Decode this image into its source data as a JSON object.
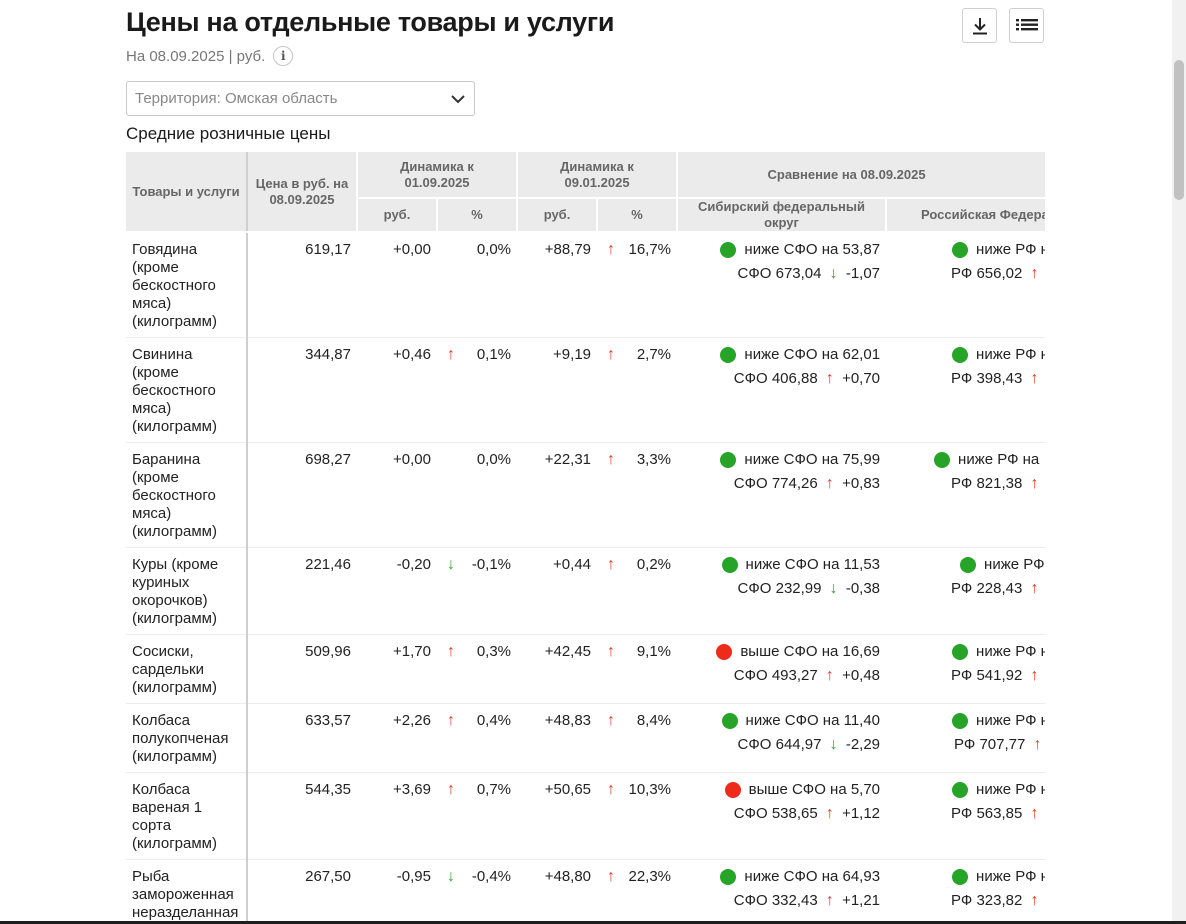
{
  "header": {
    "title": "Цены на отдельные товары и услуги",
    "subtitle": "На 08.09.2025 | руб.",
    "info_icon": "i"
  },
  "toolbar": {
    "download_icon": "download-icon",
    "list_icon": "list-icon"
  },
  "territory_select": {
    "value": "Территория: Омская область"
  },
  "section_title": "Средние розничные цены",
  "colors": {
    "up": "#e33a1f",
    "down": "#2ea52e",
    "dot_green": "#27a327",
    "dot_red": "#ee2a1b",
    "header_bg": "#ebebeb"
  },
  "table": {
    "headers": {
      "goods": "Товары и услуги",
      "price": "Цена в руб. на 08.09.2025",
      "dyn1": "Динамика к 01.09.2025",
      "dyn2": "Динамика к 09.01.2025",
      "compare": "Сравнение на 08.09.2025",
      "sfo": "Сибирский федеральный округ",
      "rf": "Российская Федерация",
      "rub": "руб.",
      "pct": "%"
    },
    "rows": [
      {
        "name": "Говядина (кроме бескостного мяса) (килограмм)",
        "price": "619,17",
        "d1_rub": "+0,00",
        "d1_dir": "",
        "d1_pct": "0,0%",
        "d2_rub": "+88,79",
        "d2_dir": "up",
        "d2_pct": "16,7%",
        "sfo_dot": "green",
        "sfo_text": "ниже СФО на 53,87",
        "sfo_value": "СФО 673,04",
        "sfo_dir": "down",
        "sfo_delta": "-1,07",
        "rf_dot": "green",
        "rf_text": "ниже РФ на",
        "rf_value": "РФ 656,02",
        "rf_dir": "up"
      },
      {
        "name": "Свинина (кроме бескостного мяса) (килограмм)",
        "price": "344,87",
        "d1_rub": "+0,46",
        "d1_dir": "up",
        "d1_pct": "0,1%",
        "d2_rub": "+9,19",
        "d2_dir": "up",
        "d2_pct": "2,7%",
        "sfo_dot": "green",
        "sfo_text": "ниже СФО на 62,01",
        "sfo_value": "СФО 406,88",
        "sfo_dir": "up",
        "sfo_delta": "+0,70",
        "rf_dot": "green",
        "rf_text": "ниже РФ на",
        "rf_value": "РФ 398,43",
        "rf_dir": "up"
      },
      {
        "name": "Баранина (кроме бескостного мяса) (килограмм)",
        "price": "698,27",
        "d1_rub": "+0,00",
        "d1_dir": "",
        "d1_pct": "0,0%",
        "d2_rub": "+22,31",
        "d2_dir": "up",
        "d2_pct": "3,3%",
        "sfo_dot": "green",
        "sfo_text": "ниже СФО на 75,99",
        "sfo_value": "СФО 774,26",
        "sfo_dir": "up",
        "sfo_delta": "+0,83",
        "rf_dot": "green",
        "rf_text": "ниже РФ на",
        "rf_value": "РФ 821,38",
        "rf_dir": "up"
      },
      {
        "name": "Куры (кроме куриных окорочков) (килограмм)",
        "price": "221,46",
        "d1_rub": "-0,20",
        "d1_dir": "down",
        "d1_pct": "-0,1%",
        "d2_rub": "+0,44",
        "d2_dir": "up",
        "d2_pct": "0,2%",
        "sfo_dot": "green",
        "sfo_text": "ниже СФО на 11,53",
        "sfo_value": "СФО 232,99",
        "sfo_dir": "down",
        "sfo_delta": "-0,38",
        "rf_dot": "green",
        "rf_text": "ниже РФ н",
        "rf_value": "РФ 228,43",
        "rf_dir": "up"
      },
      {
        "name": "Сосиски, сардельки (килограмм)",
        "price": "509,96",
        "d1_rub": "+1,70",
        "d1_dir": "up",
        "d1_pct": "0,3%",
        "d2_rub": "+42,45",
        "d2_dir": "up",
        "d2_pct": "9,1%",
        "sfo_dot": "red",
        "sfo_text": "выше СФО на 16,69",
        "sfo_value": "СФО 493,27",
        "sfo_dir": "up",
        "sfo_delta": "+0,48",
        "rf_dot": "green",
        "rf_text": "ниже РФ на",
        "rf_value": "РФ 541,92",
        "rf_dir": "up"
      },
      {
        "name": "Колбаса полукопченая (килограмм)",
        "price": "633,57",
        "d1_rub": "+2,26",
        "d1_dir": "up",
        "d1_pct": "0,4%",
        "d2_rub": "+48,83",
        "d2_dir": "up",
        "d2_pct": "8,4%",
        "sfo_dot": "green",
        "sfo_text": "ниже СФО на 11,40",
        "sfo_value": "СФО 644,97",
        "sfo_dir": "down",
        "sfo_delta": "-2,29",
        "rf_dot": "green",
        "rf_text": "ниже РФ на",
        "rf_value": "РФ 707,77",
        "rf_dir": "up"
      },
      {
        "name": "Колбаса вареная 1 сорта (килограмм)",
        "price": "544,35",
        "d1_rub": "+3,69",
        "d1_dir": "up",
        "d1_pct": "0,7%",
        "d2_rub": "+50,65",
        "d2_dir": "up",
        "d2_pct": "10,3%",
        "sfo_dot": "red",
        "sfo_text": "выше СФО на 5,70",
        "sfo_value": "СФО 538,65",
        "sfo_dir": "up",
        "sfo_delta": "+1,12",
        "rf_dot": "green",
        "rf_text": "ниже РФ на",
        "rf_value": "РФ 563,85",
        "rf_dir": "up"
      },
      {
        "name": "Рыба замороженная неразделанная (килограмм)",
        "price": "267,50",
        "d1_rub": "-0,95",
        "d1_dir": "down",
        "d1_pct": "-0,4%",
        "d2_rub": "+48,80",
        "d2_dir": "up",
        "d2_pct": "22,3%",
        "sfo_dot": "green",
        "sfo_text": "ниже СФО на 64,93",
        "sfo_value": "СФО 332,43",
        "sfo_dir": "up",
        "sfo_delta": "+1,21",
        "rf_dot": "green",
        "rf_text": "ниже РФ на",
        "rf_value": "РФ 323,82",
        "rf_dir": "up"
      }
    ]
  }
}
